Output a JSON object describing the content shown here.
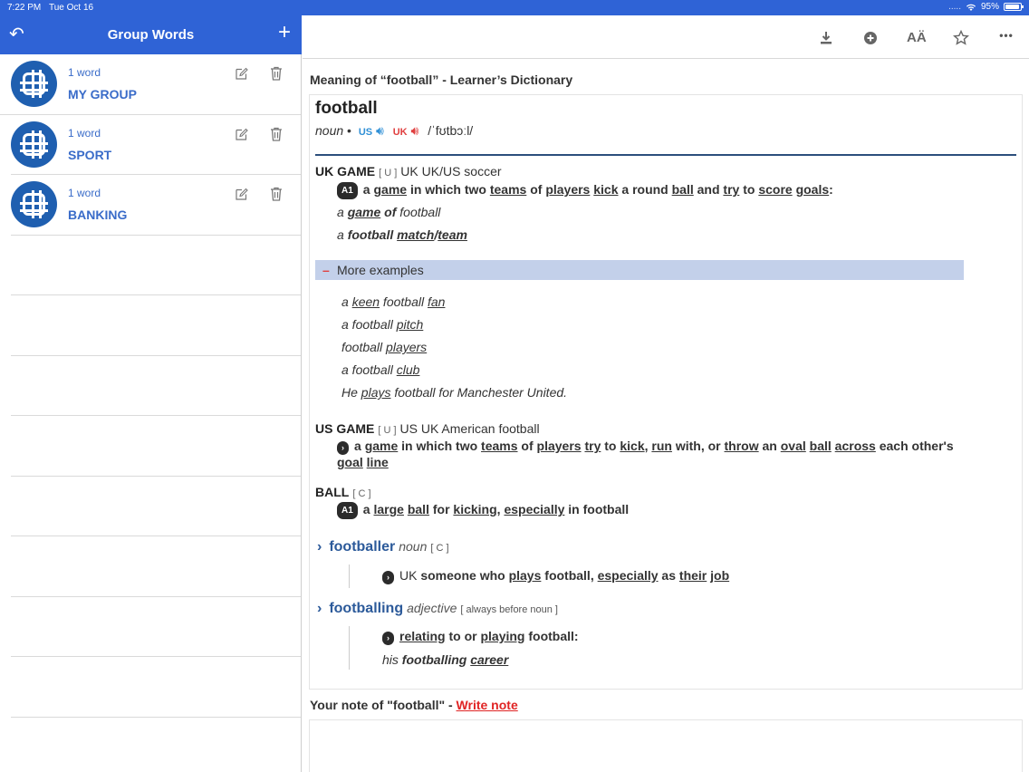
{
  "status": {
    "time": "7:22 PM",
    "date": "Tue Oct 16",
    "signal": ".....",
    "battery": "95%",
    "battery_level": 0.95
  },
  "sidebar": {
    "title": "Group Words",
    "groups": [
      {
        "count": "1 word",
        "name": "MY GROUP"
      },
      {
        "count": "1 word",
        "name": "SPORT"
      },
      {
        "count": "1 word",
        "name": "BANKING"
      }
    ]
  },
  "toolbar": {
    "icons": [
      "download-icon",
      "plus-circle-icon",
      "text-size-icon",
      "star-icon",
      "more-icon"
    ],
    "text_size_glyph": "AÄ",
    "more_glyph": "•••"
  },
  "main": {
    "meaning_title": "Meaning of “football” - Learner’s Dictionary",
    "headword": "football",
    "pos": "noun",
    "bullet": "•",
    "us_label": "US",
    "uk_label": "UK",
    "ipa": "/ˈfʊtbɔːl/",
    "senses": {
      "uk_game": {
        "title": "UK GAME",
        "gram": "[ U ]",
        "region": "UK UK/US soccer",
        "level": "A1"
      },
      "us_game": {
        "title": "US GAME",
        "gram": "[ U ]",
        "region": "US UK American football"
      },
      "ball": {
        "title": "BALL",
        "gram": "[ C ]",
        "level": "A1"
      }
    },
    "more_examples_label": "More examples",
    "more_examples": [
      "a keen football fan",
      "a football pitch",
      "football players",
      "a football club",
      "He plays football for Manchester United."
    ],
    "derivatives": [
      {
        "word": "footballer",
        "pos": "noun",
        "gram": "[ C ]"
      },
      {
        "word": "footballing",
        "pos": "adjective",
        "gram": "[ always before noun ]"
      }
    ],
    "note": {
      "label": "Your note of \"football\" - ",
      "link": "Write note"
    }
  },
  "colors": {
    "header_blue": "#2f63d6",
    "link_blue": "#3a6cc9",
    "headword_blue": "#2c5a9a",
    "more_bar": "#c3d0ea",
    "accent_red": "#e02424"
  }
}
